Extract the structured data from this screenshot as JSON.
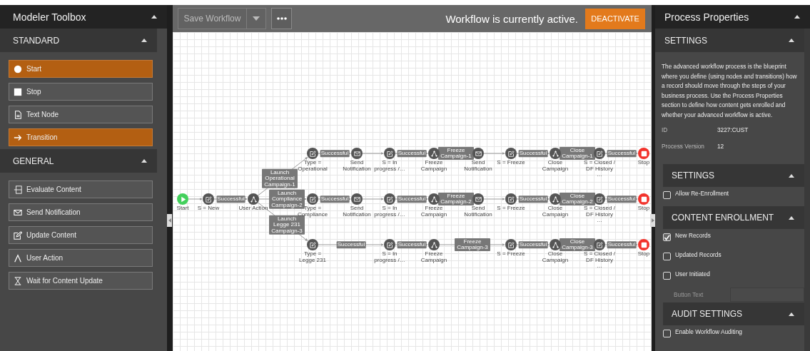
{
  "toolbox": {
    "title": "Modeler Toolbox",
    "expanded": true,
    "sections": [
      {
        "title": "STANDARD",
        "expanded": true,
        "items": [
          {
            "label": "Start",
            "kind": "start",
            "selected": true
          },
          {
            "label": "Stop",
            "kind": "stop",
            "selected": false
          },
          {
            "label": "Text Node",
            "kind": "text",
            "selected": false
          },
          {
            "label": "Transition",
            "kind": "transition",
            "selected": true
          }
        ]
      },
      {
        "title": "GENERAL",
        "expanded": true,
        "items": [
          {
            "label": "Evaluate Content",
            "kind": "evaluate",
            "selected": false
          },
          {
            "label": "Send Notification",
            "kind": "notify",
            "selected": false
          },
          {
            "label": "Update Content",
            "kind": "update",
            "selected": false
          },
          {
            "label": "User Action",
            "kind": "action",
            "selected": false
          },
          {
            "label": "Wait for Content Update",
            "kind": "wait",
            "selected": false
          }
        ]
      }
    ]
  },
  "toolbar": {
    "save_label": "Save Workflow",
    "status": "Workflow is currently active.",
    "action_label": "DEACTIVATE"
  },
  "diagram": {
    "trunk": [
      {
        "kind": "start",
        "label": "Start"
      },
      {
        "kind": "update",
        "label": "S = New"
      },
      {
        "kind": "action",
        "label": "User Action",
        "transition": "Successful"
      }
    ],
    "branches": [
      {
        "steps": [
          {
            "kind": "update",
            "label": "Type = Operational",
            "transition": "Launch Operational Campaign-1"
          },
          {
            "kind": "notify",
            "label": "Send Notification",
            "transition": "Successful"
          },
          {
            "kind": "update",
            "label": "S = In progress /…"
          },
          {
            "kind": "action",
            "label": "Freeze Campaign",
            "transition": "Successful"
          },
          {
            "kind": "notify",
            "label": "Send Notification",
            "transition": "Freeze Campaign-1"
          },
          {
            "kind": "update",
            "label": "S = Freeze"
          },
          {
            "kind": "action",
            "label": "Close Campaign",
            "transition": "Successful"
          },
          {
            "kind": "update",
            "label": "S = Closed / DF History …",
            "transition": "Close Campaign-1"
          },
          {
            "kind": "stop",
            "label": "Stop",
            "transition": "Successful"
          }
        ]
      },
      {
        "steps": [
          {
            "kind": "update",
            "label": "Type = Compliance",
            "transition": "Launch Compliance Campaign-2"
          },
          {
            "kind": "notify",
            "label": "Send Notification",
            "transition": "Successful"
          },
          {
            "kind": "update",
            "label": "S = In progress /…"
          },
          {
            "kind": "action",
            "label": "Freeze Campaign",
            "transition": "Successful"
          },
          {
            "kind": "notify",
            "label": "Send Notification",
            "transition": "Freeze Campaign-2"
          },
          {
            "kind": "update",
            "label": "S = Freeze"
          },
          {
            "kind": "action",
            "label": "Close Campaign",
            "transition": "Successful"
          },
          {
            "kind": "update",
            "label": "S = Closed / DF History …",
            "transition": "Close Campaign-2"
          },
          {
            "kind": "stop",
            "label": "Stop",
            "transition": "Successful"
          }
        ]
      },
      {
        "steps": [
          {
            "kind": "update",
            "label": "Type = Legge 231",
            "transition": "Launch Legge 231 Campaign-3"
          },
          {
            "kind": "update",
            "label": "S = In progress /…",
            "transition": "Successful"
          },
          {
            "kind": "action",
            "label": "Freeze Campaign",
            "transition": "Successful"
          },
          {
            "kind": "update",
            "label": "S = Freeze",
            "transition": "Freeze Campaign-3"
          },
          {
            "kind": "action",
            "label": "Close Campaign",
            "transition": "Successful"
          },
          {
            "kind": "update",
            "label": "S = Closed / DF History …",
            "transition": "Close Campaign-3"
          },
          {
            "kind": "stop",
            "label": "Stop",
            "transition": "Successful"
          }
        ]
      }
    ]
  },
  "properties": {
    "title": "Process Properties",
    "expanded": true,
    "settings": {
      "title": "SETTINGS",
      "expanded": true,
      "description": "The advanced workflow process is the blueprint where you define (using nodes and transitions) how a record should move through the steps of your business process. Use the Process Properties section to define how content gets enrolled and whether your advanced workflow is active.",
      "fields": [
        {
          "label": "ID",
          "value": "3227:CUST"
        },
        {
          "label": "Process Version",
          "value": "12"
        }
      ]
    },
    "subsections": [
      {
        "title": "SETTINGS",
        "expanded": true,
        "rows": [
          {
            "kind": "checkbox",
            "label": "Allow Re-Enrollment",
            "checked": false
          }
        ]
      },
      {
        "title": "CONTENT ENROLLMENT",
        "expanded": true,
        "rows": [
          {
            "kind": "checkbox",
            "label": "New Records",
            "checked": true
          },
          {
            "kind": "checkbox",
            "label": "Updated Records",
            "checked": false
          },
          {
            "kind": "checkbox",
            "label": "User Initiated",
            "checked": false
          },
          {
            "kind": "field",
            "label": "Button Text",
            "disabled": true
          }
        ]
      },
      {
        "title": "AUDIT SETTINGS",
        "expanded": true,
        "rows": [
          {
            "kind": "checkbox",
            "label": "Enable Workflow Auditing",
            "checked": false
          }
        ]
      }
    ]
  }
}
